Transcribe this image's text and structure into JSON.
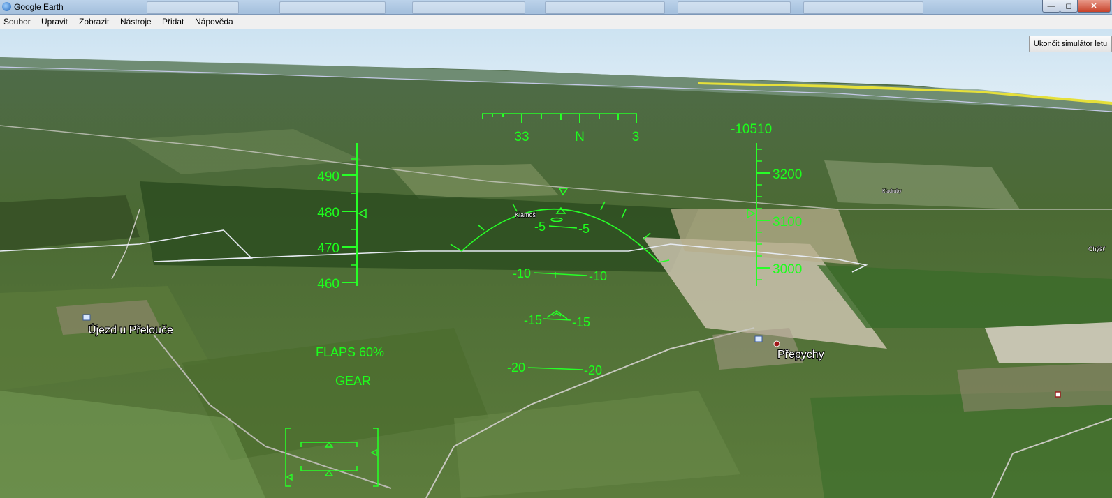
{
  "window": {
    "title": "Google Earth"
  },
  "menu": [
    "Soubor",
    "Upravit",
    "Zobrazit",
    "Nástroje",
    "Přidat",
    "Nápověda"
  ],
  "exit_button": "Ukončit simulátor letu",
  "hud": {
    "heading": {
      "left": "33",
      "center": "N",
      "right": "3"
    },
    "vertical_speed": "-10510",
    "speed_ticks": [
      "490",
      "480",
      "470",
      "460"
    ],
    "altitude_ticks": [
      "3200",
      "3100",
      "3000"
    ],
    "pitch": [
      {
        "left": "-5",
        "right": "-5"
      },
      {
        "left": "-10",
        "right": "-10"
      },
      {
        "left": "-15",
        "right": "-15"
      },
      {
        "left": "-20",
        "right": "-20"
      }
    ],
    "flaps": "FLAPS 60%",
    "gear": "GEAR"
  },
  "places": {
    "ujezd": "Újezd u Přelouče",
    "prepychy": "Přepychy",
    "klamos": "Klamoš",
    "small1": "Kladruby",
    "small2": "Chýšť"
  },
  "colors": {
    "hud": "#27ff27",
    "sky_top": "#cfe6f4",
    "terrain": "#4d6b36"
  }
}
